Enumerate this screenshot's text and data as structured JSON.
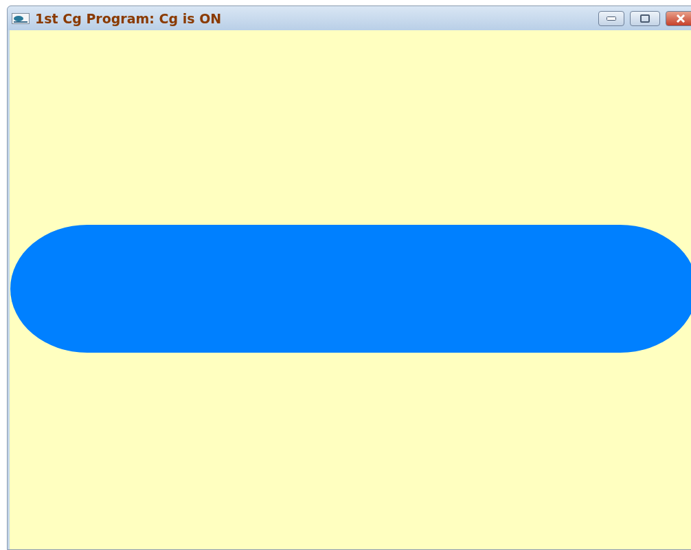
{
  "window": {
    "title": "1st Cg Program: Cg is ON"
  }
}
